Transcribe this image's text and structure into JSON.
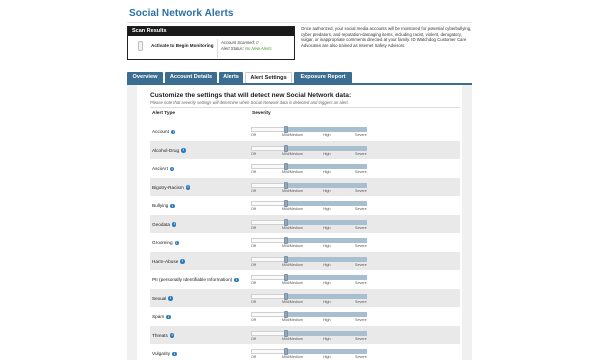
{
  "page": {
    "title": "Social Network Alerts"
  },
  "scan": {
    "header": "Scan Results",
    "activate_label": "Activate to Begin Monitoring",
    "accounts_label": "Account Scanned:",
    "accounts_value": "0",
    "status_label": "Alert Status:",
    "status_value": "No New Alerts"
  },
  "description": "Once authorized, your social media accounts will be monitored for potential cyberbullying, cyber predators, and reputation-damaging items, including racist, violent, derogatory, vulgar, or inappropriate comments directed at your family. ID Watchdog Customer Care Advocates are also trained as Internet Safety Advisors.",
  "tabs": [
    {
      "label": "Overview",
      "active": false
    },
    {
      "label": "Account Details",
      "active": false
    },
    {
      "label": "Alerts",
      "active": false
    },
    {
      "label": "Alert Settings",
      "active": true
    },
    {
      "label": "Exposure Report",
      "active": false
    }
  ],
  "settings": {
    "heading": "Customize the settings that will detect new Social Network data:",
    "note": "Please note that severity settings will determine when Social Network data is detected and triggers an alert.",
    "columns": {
      "type": "Alert Type",
      "severity": "Severity"
    },
    "scale": {
      "off": "Off",
      "mild": "Mild/Medium",
      "high": "High",
      "severe": "Severe"
    },
    "rows": [
      {
        "label": "Account",
        "severity": "Mild/Medium"
      },
      {
        "label": "Alcohol-Drug",
        "severity": "Mild/Medium"
      },
      {
        "label": "AsciiArt",
        "severity": "Mild/Medium"
      },
      {
        "label": "Bigotry-Racism",
        "severity": "Mild/Medium"
      },
      {
        "label": "Bullying",
        "severity": "Mild/Medium"
      },
      {
        "label": "Geodata",
        "severity": "Mild/Medium"
      },
      {
        "label": "Grooming",
        "severity": "Mild/Medium"
      },
      {
        "label": "Harm-Abuse",
        "severity": "Mild/Medium"
      },
      {
        "label": "PII (personally Identifiable Information)",
        "severity": "Mild/Medium"
      },
      {
        "label": "Sexual",
        "severity": "Mild/Medium"
      },
      {
        "label": "Spam",
        "severity": "Mild/Medium"
      },
      {
        "label": "Threats",
        "severity": "Mild/Medium"
      },
      {
        "label": "Vulgarity",
        "severity": "Mild/Medium"
      }
    ]
  },
  "colors": {
    "title": "#2a6fa8",
    "tab": "#3a6d8f",
    "slider_fill": "#a8bfd0",
    "info_icon": "#2b7bbb",
    "status_ok": "#4a9a3a"
  }
}
